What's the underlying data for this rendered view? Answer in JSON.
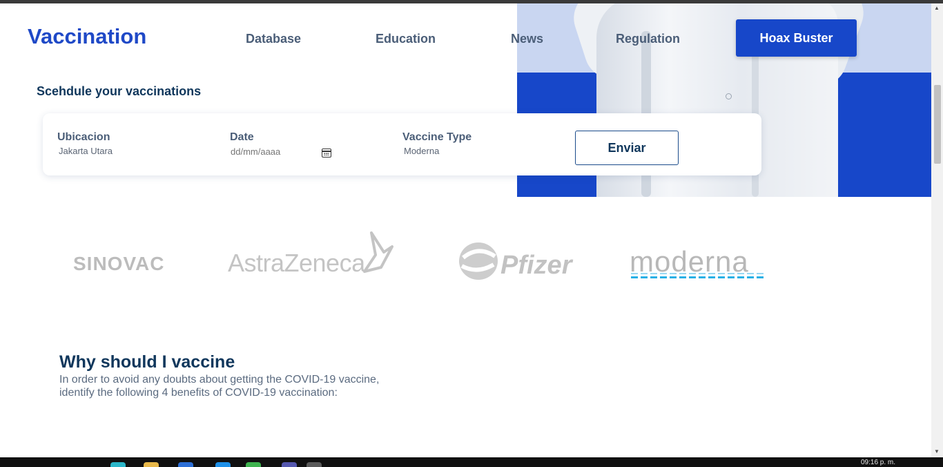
{
  "nav": {
    "brand": "Vaccination",
    "links": [
      "Database",
      "Education",
      "News",
      "Regulation"
    ],
    "cta": "Hoax Buster"
  },
  "schedule": {
    "title": "Scehdule your vaccinations",
    "location": {
      "label": "Ubicacion",
      "value": "Jakarta Utara"
    },
    "date": {
      "label": "Date",
      "placeholder": "dd/mm/aaaa"
    },
    "vaccine": {
      "label": "Vaccine Type",
      "value": "Moderna"
    },
    "submit": "Enviar"
  },
  "logos": {
    "sinovac": "SINOVAC",
    "astrazeneca": "AstraZeneca",
    "pfizer": "Pfizer",
    "moderna": "moderna"
  },
  "why": {
    "title": "Why should I vaccine",
    "text": "In order to avoid any doubts about getting the COVID-19 vaccine, identify the following 4 benefits of COVID-19 vaccination:"
  },
  "taskbar": {
    "clock": "09:16 p. m."
  },
  "colors": {
    "primary": "#1747c9",
    "heading": "#10375c",
    "nav_text": "#4b5e78"
  }
}
